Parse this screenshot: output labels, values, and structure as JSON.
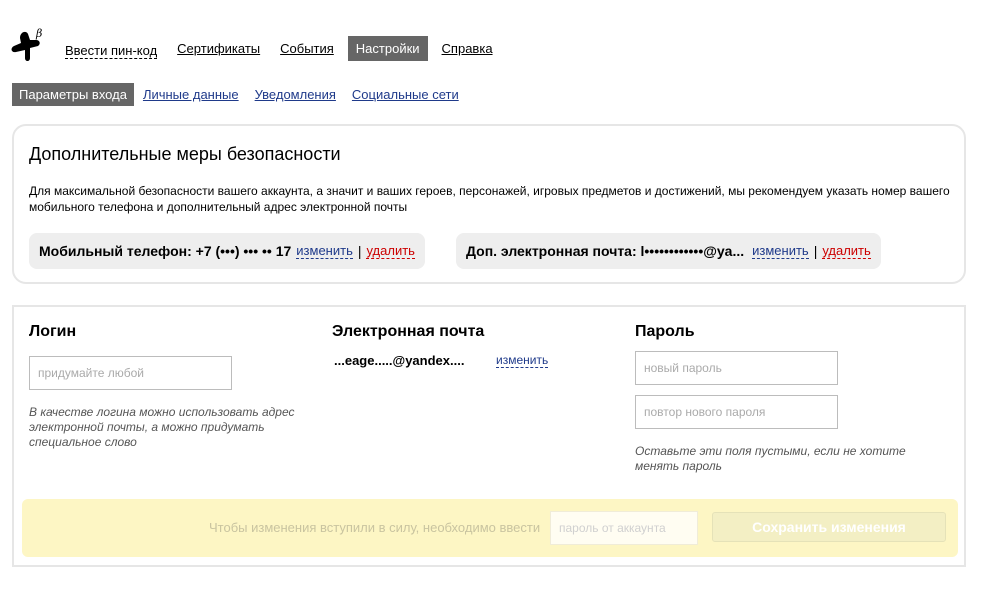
{
  "app": {
    "logo_icon": "beta-logo-icon",
    "beta_mark": "β"
  },
  "top_nav": {
    "items": [
      {
        "label": "Ввести пин-код",
        "style": "dashed"
      },
      {
        "label": "Сертификаты",
        "style": "underline"
      },
      {
        "label": "События",
        "style": "underline"
      },
      {
        "label": "Настройки",
        "style": "active"
      },
      {
        "label": "Справка",
        "style": "underline"
      }
    ]
  },
  "sub_nav": {
    "items": [
      {
        "label": "Параметры входа",
        "active": true
      },
      {
        "label": "Личные данные",
        "active": false
      },
      {
        "label": "Уведомления",
        "active": false
      },
      {
        "label": "Социальные сети",
        "active": false
      }
    ]
  },
  "security": {
    "title": "Дополнительные меры безопасности",
    "description": "Для максимальной безопасности вашего аккаунта, а значит и ваших героев, персонажей, игровых предметов и достижений, мы рекомендуем указать номер вашего мобильного телефона и дополнительный адрес электронной почты",
    "phone": {
      "label": "Мобильный телефон: +7 (•••) ••• •• 17",
      "change": "изменить",
      "separator": "|",
      "delete": "удалить"
    },
    "email": {
      "label": "Доп. электронная почта: l••••••••••••@ya...",
      "change": "изменить",
      "separator": "|",
      "delete": "удалить"
    }
  },
  "form": {
    "login": {
      "title": "Логин",
      "placeholder": "придумайте любой",
      "hint": "В качестве логина можно использовать адрес электронной почты, а можно придумать специальное слово"
    },
    "email": {
      "title": "Электронная почта",
      "value": "...eage.....@yandex....",
      "change": "изменить"
    },
    "password": {
      "title": "Пароль",
      "new_placeholder": "новый пароль",
      "repeat_placeholder": "повтор нового пароля",
      "hint": "Оставьте эти поля пустыми, если не хотите менять пароль"
    },
    "save": {
      "note": "Чтобы изменения вступили в силу, необходимо ввести",
      "password_placeholder": "пароль от аккаунта",
      "button": "Сохранить изменения"
    }
  },
  "colors": {
    "active_tab": "#666666",
    "link": "#1f3a8a",
    "delete": "#cc0000",
    "save_bar": "#fdf6c4"
  }
}
